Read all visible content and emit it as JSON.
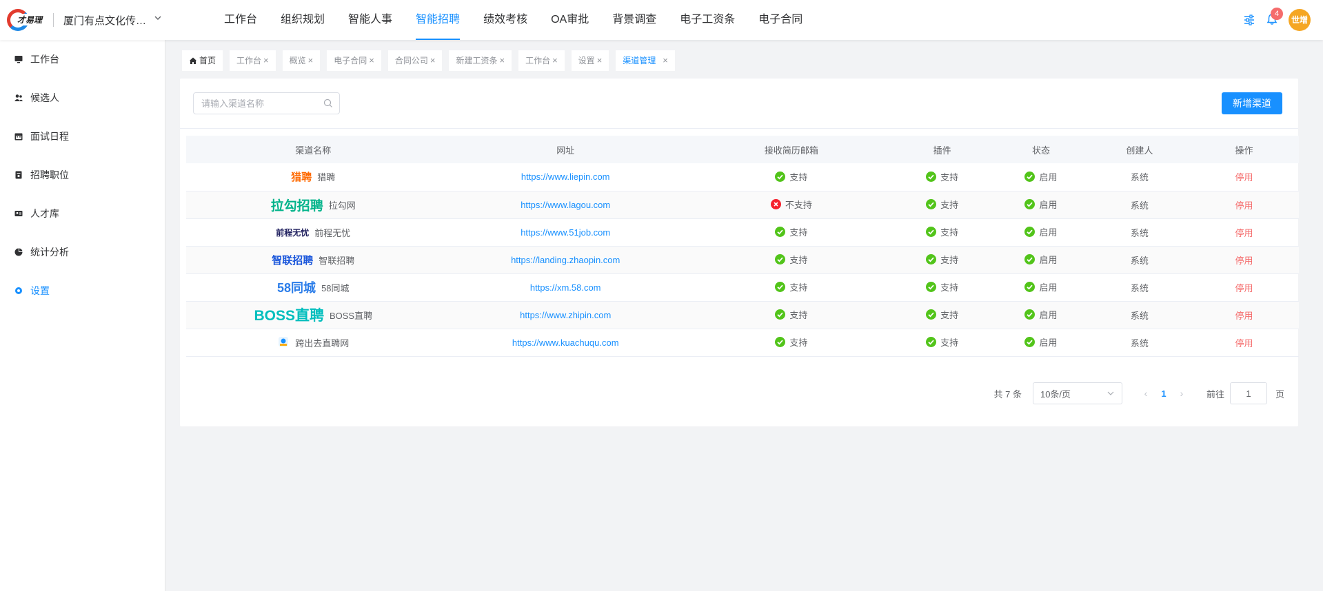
{
  "topbar": {
    "logo_text": "才易理",
    "company": "厦门有点文化传…",
    "nav": [
      "工作台",
      "组织规划",
      "智能人事",
      "智能招聘",
      "绩效考核",
      "OA审批",
      "背景调查",
      "电子工资条",
      "电子合同"
    ],
    "active_nav": "智能招聘",
    "notification_count": "4",
    "avatar_text": "世增"
  },
  "sidebar": {
    "items": [
      {
        "label": "工作台",
        "icon": "monitor-icon"
      },
      {
        "label": "候选人",
        "icon": "users-icon"
      },
      {
        "label": "面试日程",
        "icon": "calendar-icon"
      },
      {
        "label": "招聘职位",
        "icon": "document-icon"
      },
      {
        "label": "人才库",
        "icon": "id-card-icon"
      },
      {
        "label": "统计分析",
        "icon": "pie-chart-icon"
      },
      {
        "label": "设置",
        "icon": "gear-icon"
      }
    ],
    "active": "设置"
  },
  "tabs": [
    "首页",
    "工作台",
    "概览",
    "电子合同",
    "合同公司",
    "新建工资条",
    "工作台",
    "设置",
    "渠道管理"
  ],
  "active_tab": "渠道管理",
  "toolbar": {
    "search_placeholder": "请输入渠道名称",
    "add_label": "新增渠道"
  },
  "table": {
    "columns": [
      "渠道名称",
      "网址",
      "接收简历邮箱",
      "插件",
      "状态",
      "创建人",
      "操作"
    ],
    "rows": [
      {
        "logo": "猎聘",
        "name": "猎聘",
        "url": "https://www.liepin.com",
        "email": "支持",
        "email_ok": true,
        "plugin": "支持",
        "status": "启用",
        "creator": "系统",
        "action": "停用"
      },
      {
        "logo": "拉勾招聘",
        "name": "拉勾网",
        "url": "https://www.lagou.com",
        "email": "不支持",
        "email_ok": false,
        "plugin": "支持",
        "status": "启用",
        "creator": "系统",
        "action": "停用"
      },
      {
        "logo": "前程无忧",
        "name": "前程无忧",
        "url": "https://www.51job.com",
        "email": "支持",
        "email_ok": true,
        "plugin": "支持",
        "status": "启用",
        "creator": "系统",
        "action": "停用"
      },
      {
        "logo": "智联招聘",
        "name": "智联招聘",
        "url": "https://landing.zhaopin.com",
        "email": "支持",
        "email_ok": true,
        "plugin": "支持",
        "status": "启用",
        "creator": "系统",
        "action": "停用"
      },
      {
        "logo": "58同城",
        "name": "58同城",
        "url": "https://xm.58.com",
        "email": "支持",
        "email_ok": true,
        "plugin": "支持",
        "status": "启用",
        "creator": "系统",
        "action": "停用"
      },
      {
        "logo": "BOSS直聘",
        "name": "BOSS直聘",
        "url": "https://www.zhipin.com",
        "email": "支持",
        "email_ok": true,
        "plugin": "支持",
        "status": "启用",
        "creator": "系统",
        "action": "停用"
      },
      {
        "logo": "",
        "name": "跨出去直聘网",
        "url": "https://www.kuachuqu.com",
        "email": "支持",
        "email_ok": true,
        "plugin": "支持",
        "status": "启用",
        "creator": "系统",
        "action": "停用"
      }
    ]
  },
  "pagination": {
    "total": "共 7 条",
    "page_size": "10条/页",
    "current": "1",
    "goto_label": "前往",
    "goto_value": "1",
    "page_unit": "页"
  },
  "colors": {
    "primary": "#1890ff",
    "ok": "#52c41a",
    "error": "#f5222d",
    "danger_text": "#f56c6c",
    "avatar": "#f5a623"
  }
}
